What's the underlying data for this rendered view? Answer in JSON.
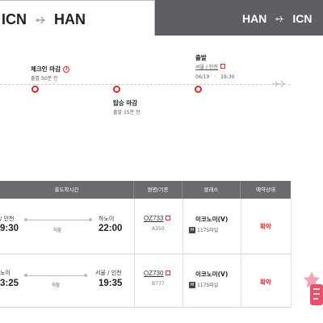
{
  "tabs": {
    "active": {
      "from": "ICN",
      "to": "HAN"
    },
    "inactive": {
      "from": "HAN",
      "to": "ICN"
    }
  },
  "timeline": {
    "checkin": {
      "title": "체크인 마감",
      "sub": "출발 50분 전"
    },
    "boarding": {
      "title": "탑승 마감",
      "sub": "출발 15분 전"
    },
    "departure": {
      "title": "출발",
      "city": "서울 / 인천",
      "date": "06/19",
      "time": "19:30"
    }
  },
  "table": {
    "headers": {
      "schedule": "출도착시간",
      "flight": "편명/기종",
      "cabin": "클래스",
      "status": "예약상태"
    },
    "rows": [
      {
        "dep_city": "/ 인천",
        "dep_time": "9:30",
        "arr_city": "하노이",
        "arr_time": "22:00",
        "direct": "직항",
        "flight_no": "OZ733",
        "aircraft": "A350",
        "cabin": "이코노미(V)",
        "miles": "1175마일",
        "status": "확약"
      },
      {
        "dep_city": "노이",
        "dep_time": "3:25",
        "arr_city": "서울 / 인천",
        "arr_time": "19:35",
        "direct": "직항",
        "flight_no": "OZ730",
        "aircraft": "B777",
        "cabin": "이코노미(V)",
        "miles": "1175마일",
        "status": "확약"
      }
    ]
  },
  "miles_icon_text": "M",
  "info_icon_text": "i",
  "colors": {
    "accent": "#e0262f",
    "header_bg": "#6b6b6f",
    "inactive_tab": "#5f5f63"
  }
}
